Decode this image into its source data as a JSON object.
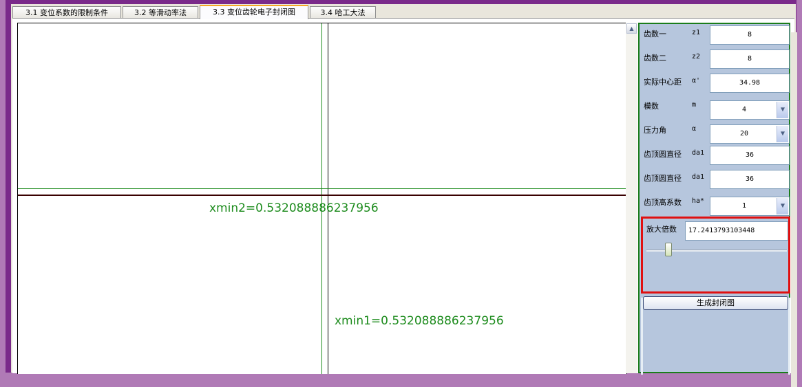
{
  "tabs": [
    {
      "label": "3.1 变位系数的限制条件",
      "active": false
    },
    {
      "label": "3.2 等滑动率法",
      "active": false
    },
    {
      "label": "3.3 变位齿轮电子封闭图",
      "active": true
    },
    {
      "label": "3.4 哈工大法",
      "active": false
    }
  ],
  "canvas": {
    "xmin2_label": "xmin2=0.532088886237956",
    "xmin1_label": "xmin1=0.532088886237956"
  },
  "params": [
    {
      "label": "齿数一",
      "symbol": "z1",
      "value": "8",
      "type": "input"
    },
    {
      "label": "齿数二",
      "symbol": "z2",
      "value": "8",
      "type": "input"
    },
    {
      "label": "实际中心距",
      "symbol": "α'",
      "value": "34.98",
      "type": "input"
    },
    {
      "label": "模数",
      "symbol": "m",
      "value": "4",
      "type": "select"
    },
    {
      "label": "压力角",
      "symbol": "α",
      "value": "20",
      "type": "select"
    },
    {
      "label": "齿顶圆直径",
      "symbol": "da1",
      "value": "36",
      "type": "input"
    },
    {
      "label": "齿顶圆直径",
      "symbol": "da1",
      "value": "36",
      "type": "input"
    },
    {
      "label": "齿顶高系数",
      "symbol": "ha*",
      "value": "1",
      "type": "select"
    }
  ],
  "zoom": {
    "label": "放大倍数",
    "value": "17.2413793103448",
    "slider_fraction": 0.14
  },
  "generate_button": "生成封闭图",
  "colors": {
    "green_border": "#1a7d1a",
    "red_border": "#e01010",
    "panel_bg": "#b6c6dd",
    "curve_green": "#1e8c1e",
    "curve_dark": "#3a0000"
  }
}
